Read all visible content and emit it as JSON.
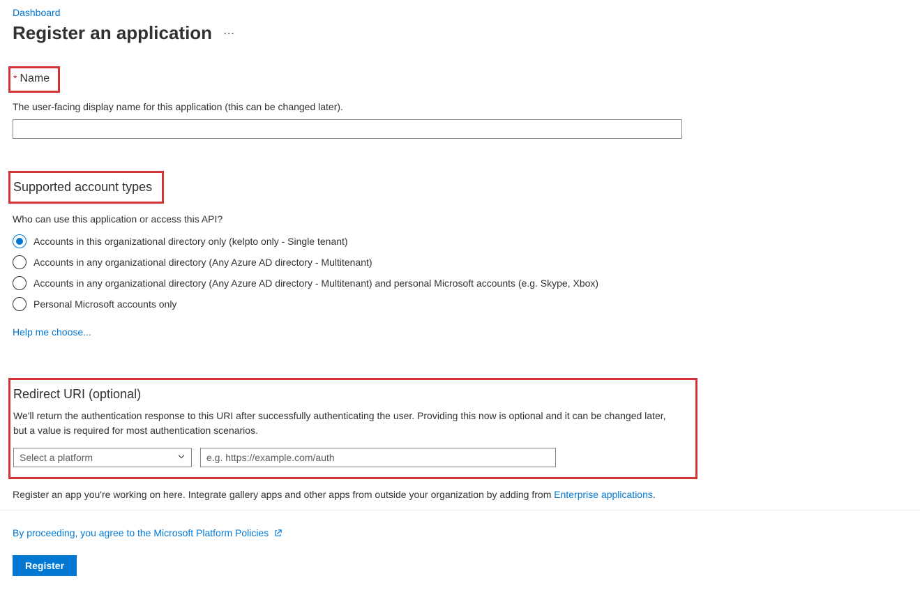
{
  "breadcrumb": "Dashboard",
  "title": "Register an application",
  "name_section": {
    "required_mark": "*",
    "label": "Name",
    "description": "The user-facing display name for this application (this can be changed later).",
    "value": ""
  },
  "account_types": {
    "heading": "Supported account types",
    "question": "Who can use this application or access this API?",
    "options": [
      "Accounts in this organizational directory only (kelpto only - Single tenant)",
      "Accounts in any organizational directory (Any Azure AD directory - Multitenant)",
      "Accounts in any organizational directory (Any Azure AD directory - Multitenant) and personal Microsoft accounts (e.g. Skype, Xbox)",
      "Personal Microsoft accounts only"
    ],
    "selected_index": 0,
    "help_link": "Help me choose..."
  },
  "redirect": {
    "heading": "Redirect URI (optional)",
    "description": "We'll return the authentication response to this URI after successfully authenticating the user. Providing this now is optional and it can be changed later, but a value is required for most authentication scenarios.",
    "platform_placeholder": "Select a platform",
    "uri_placeholder": "e.g. https://example.com/auth"
  },
  "integrate_text_prefix": "Register an app you're working on here. Integrate gallery apps and other apps from outside your organization by adding from ",
  "integrate_link": "Enterprise applications",
  "integrate_suffix": ".",
  "policies_text": "By proceeding, you agree to the Microsoft Platform Policies",
  "register_button": "Register"
}
